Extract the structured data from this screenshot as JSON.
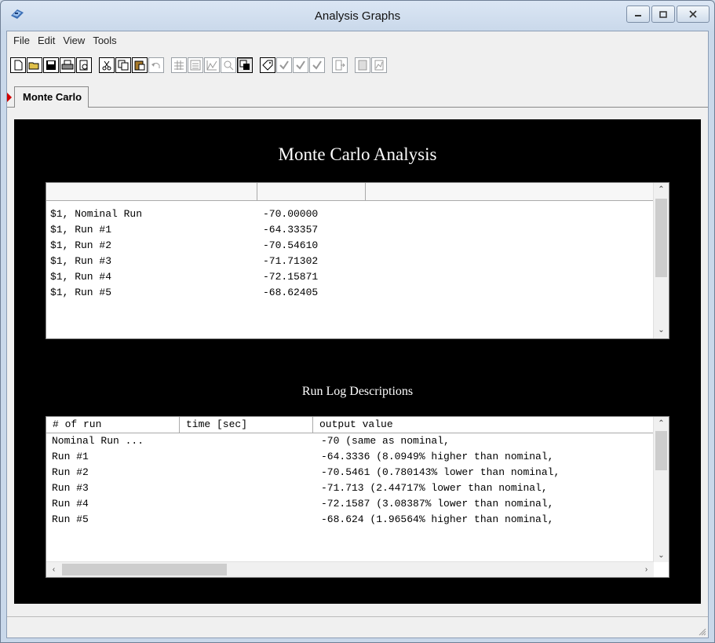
{
  "window": {
    "title": "Analysis Graphs"
  },
  "menu": [
    "File",
    "Edit",
    "View",
    "Tools"
  ],
  "tabs": [
    {
      "label": "Monte Carlo",
      "selected": true
    }
  ],
  "panel": {
    "title": "Monte Carlo Analysis",
    "results": {
      "rows": [
        {
          "name": "$1, Nominal Run",
          "value": "-70.00000"
        },
        {
          "name": "$1, Run #1",
          "value": "-64.33357"
        },
        {
          "name": "$1, Run #2",
          "value": "-70.54610"
        },
        {
          "name": "$1, Run #3",
          "value": "-71.71302"
        },
        {
          "name": "$1, Run #4",
          "value": "-72.15871"
        },
        {
          "name": "$1, Run #5",
          "value": "-68.62405"
        }
      ]
    },
    "log_title": "Run Log Descriptions",
    "log": {
      "headers": [
        "# of run",
        "time [sec]",
        "output value"
      ],
      "rows": [
        {
          "run": "Nominal Run ...",
          "time": "",
          "output": "-70 (same as nominal,"
        },
        {
          "run": "Run #1",
          "time": "",
          "output": "-64.3336 (8.0949% higher than nominal,"
        },
        {
          "run": "Run #2",
          "time": "",
          "output": "-70.5461 (0.780143% lower than nominal,"
        },
        {
          "run": "Run #3",
          "time": "",
          "output": "-71.713 (2.44717% lower than nominal,"
        },
        {
          "run": "Run #4",
          "time": "",
          "output": "-72.1587 (3.08387% lower than nominal,"
        },
        {
          "run": "Run #5",
          "time": "",
          "output": "-68.624 (1.96564% higher than nominal,"
        }
      ]
    }
  },
  "toolbar_icons": [
    "new-file-icon",
    "open-folder-icon",
    "save-icon",
    "print-icon",
    "print-preview-icon",
    "cut-icon",
    "copy-icon",
    "paste-icon",
    "undo-icon",
    "grid-icon",
    "list-icon",
    "chart-icon",
    "zoom-icon",
    "window-icon",
    "tag-icon",
    "check-icon",
    "check-tag-icon",
    "check-tag2-icon",
    "export-icon",
    "report-icon",
    "report-chart-icon"
  ],
  "colors": {
    "panel_bg": "#000000",
    "panel_text": "#ffffff",
    "marker": "#d10000"
  }
}
